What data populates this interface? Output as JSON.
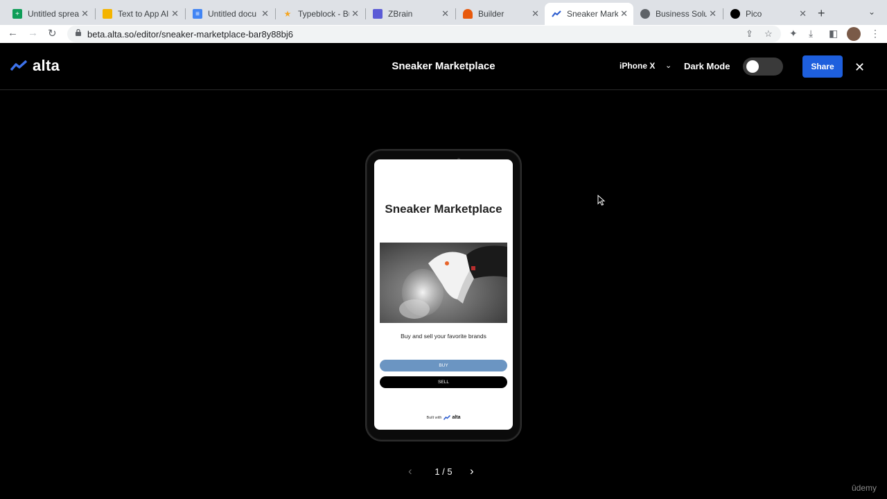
{
  "browser": {
    "tabs": [
      {
        "title": "Untitled sprea",
        "icon": "sheets-icon",
        "color": "#0f9d58"
      },
      {
        "title": "Text to App AI",
        "icon": "slides-icon",
        "color": "#f4b400"
      },
      {
        "title": "Untitled docu",
        "icon": "docs-icon",
        "color": "#4285f4"
      },
      {
        "title": "Typeblock - Bu",
        "icon": "star-icon",
        "color": "#f5a623"
      },
      {
        "title": "ZBrain",
        "icon": "zbrain-icon",
        "color": "#5b5bd6"
      },
      {
        "title": "Builder",
        "icon": "builder-icon",
        "color": "#e8590c"
      },
      {
        "title": "Sneaker Marke",
        "icon": "alta-icon",
        "color": "#2f5fd0"
      },
      {
        "title": "Business Solut",
        "icon": "globe-icon",
        "color": "#5f6368"
      },
      {
        "title": "Pico",
        "icon": "pico-icon",
        "color": "#000000"
      }
    ],
    "url": "beta.alta.so/editor/sneaker-marketplace-bar8y88bj6"
  },
  "app": {
    "logo_text": "alta",
    "title": "Sneaker Marketplace",
    "device": "iPhone X",
    "dark_mode_label": "Dark Mode",
    "dark_mode_on": false,
    "share_label": "Share",
    "accent": "#1e5fdd"
  },
  "phone_screen": {
    "title": "Sneaker Marketplace",
    "subtitle": "Buy and sell your favorite brands",
    "buy_label": "BUY",
    "sell_label": "SELL",
    "built_with": "Built with",
    "built_logo": "alta",
    "buy_color": "#6b95c2"
  },
  "pager": {
    "label": "1 / 5",
    "current": 1,
    "total": 5
  },
  "watermark": "ûdemy"
}
